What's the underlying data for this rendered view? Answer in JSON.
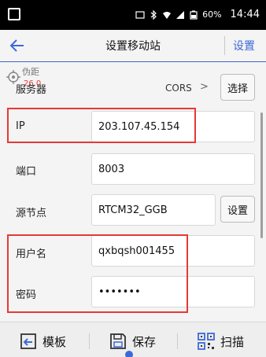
{
  "status_bar": {
    "battery": "60%",
    "time": "14:44"
  },
  "header": {
    "back_icon": "arrow-left-icon",
    "title": "设置移动站",
    "right_action": "设置"
  },
  "overlay": {
    "label": "伪距",
    "value": "26.0"
  },
  "server": {
    "label": "服务器",
    "value": "CORS",
    "button": "选择"
  },
  "fields": {
    "ip": {
      "label": "IP",
      "value": "203.107.45.154"
    },
    "port": {
      "label": "端口",
      "value": "8003"
    },
    "mountpoint": {
      "label": "源节点",
      "value": "RTCM32_GGB",
      "button": "设置"
    },
    "username": {
      "label": "用户名",
      "value": "qxbqsh001455"
    },
    "password": {
      "label": "密码",
      "value": "•••••••"
    }
  },
  "toolbar": {
    "template": "模板",
    "save": "保存",
    "scan": "扫描"
  },
  "colors": {
    "accent": "#3b6ad8",
    "highlight": "#e53935"
  }
}
